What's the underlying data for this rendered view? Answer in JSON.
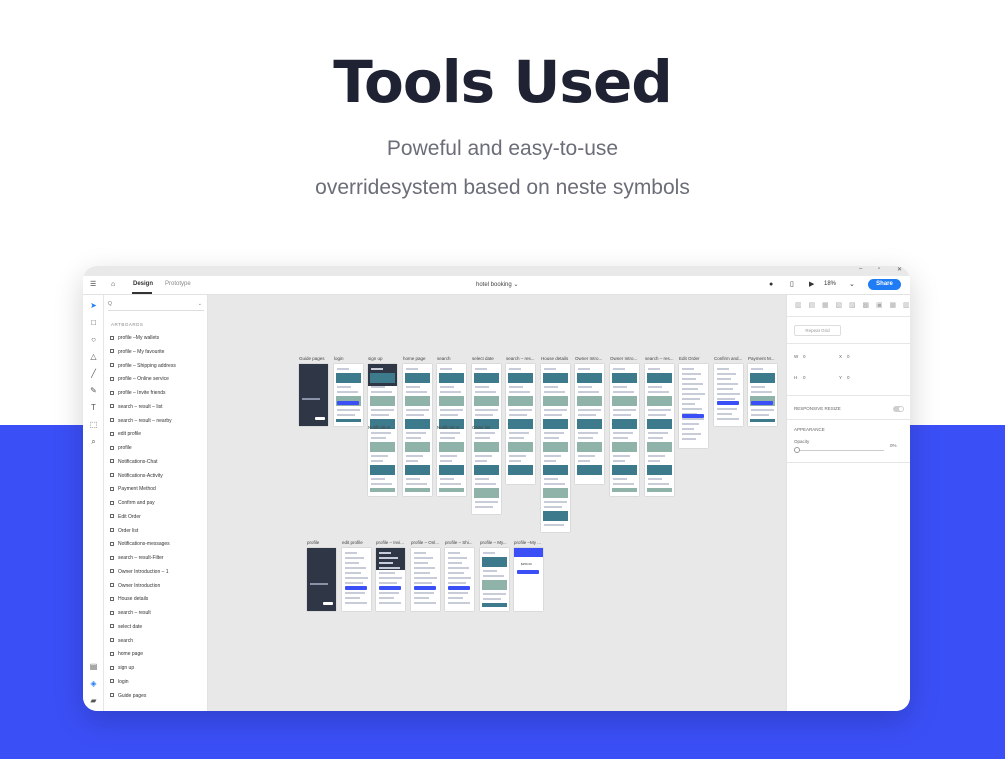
{
  "hero": {
    "title": "Tools Used",
    "subtitle_line1": "Poweful and easy-to-use",
    "subtitle_line2": "overridesystem based on neste symbols"
  },
  "colors": {
    "band": "#3b4ff7",
    "share": "#1f7cf4",
    "canvas": "#e8e8e8"
  },
  "toolbar": {
    "tab_design": "Design",
    "tab_prototype": "Prototype",
    "doc_title": "hotel booking",
    "zoom": "18%",
    "share_label": "Share"
  },
  "layers": {
    "search_placeholder": "Q",
    "heading": "ARTBOARDS",
    "items": [
      "profile –My wallets",
      "profile – My favourite",
      "profile – Shipping address",
      "profile – Online service",
      "profile – Invite friends",
      "search – result – list",
      "search – result – nearby",
      "edit profile",
      "profile",
      "Notifications-Chat",
      "Notifications-Activity",
      "Payment Method",
      "Confirm and pay",
      "Edit Order",
      "Order list",
      "Notifications-messages",
      "search – result-Filter",
      "Owner Introduction – 1",
      "Owner Introduction",
      "House details",
      "search – result",
      "select date",
      "search",
      "home page",
      "sign up",
      "login",
      "Guide pages"
    ]
  },
  "canvas": {
    "row1_labels": [
      "Guide pages",
      "login",
      "sign up",
      "home page",
      "search",
      "select date",
      "search – res...",
      "House details",
      "Owner Intro...",
      "Owner Intro...",
      "search – res...",
      "Edit Order",
      "Confirm and...",
      "Payment M...",
      "search – res...",
      "search – res..."
    ],
    "row1b_labels": [
      "Notification...",
      "Notification...",
      "Order list"
    ],
    "row2_labels": [
      "profile",
      "edit profile",
      "profile – Invi...",
      "profile – Onl...",
      "profile – Shi...",
      "profile – My...",
      "profile –My ..."
    ],
    "wallet_amount": "$250.00"
  },
  "props": {
    "repeat_grid": "Repeat Grid",
    "w_label": "W",
    "w_value": "0",
    "x_label": "X",
    "x_value": "0",
    "h_label": "H",
    "h_value": "0",
    "y_label": "Y",
    "y_value": "0",
    "responsive_resize": "RESPONSIVE RESIZE",
    "appearance": "APPEARANCE",
    "opacity_label": "Opacity",
    "opacity_value": "0%"
  }
}
